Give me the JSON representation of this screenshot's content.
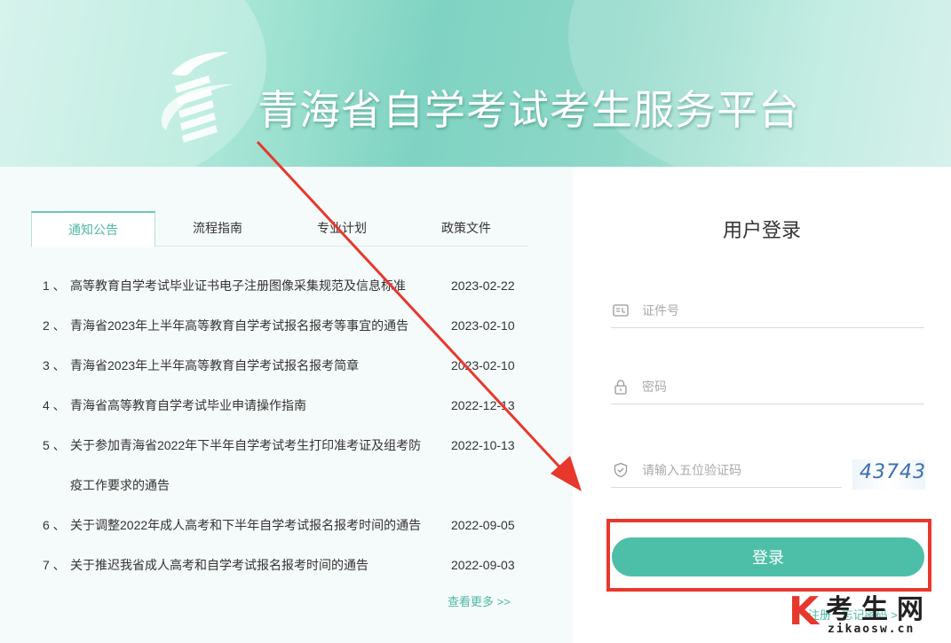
{
  "header": {
    "site_title": "青海省自学考试考生服务平台",
    "logo": "zikao-logo"
  },
  "tabs": [
    {
      "label": "通知公告",
      "active": true
    },
    {
      "label": "流程指南",
      "active": false
    },
    {
      "label": "专业计划",
      "active": false
    },
    {
      "label": "政策文件",
      "active": false
    }
  ],
  "news": [
    {
      "num": "1 、",
      "title": "高等教育自学考试毕业证书电子注册图像采集规范及信息标准",
      "date": "2023-02-22"
    },
    {
      "num": "2 、",
      "title": "青海省2023年上半年高等教育自学考试报名报考等事宜的通告",
      "date": "2023-02-10"
    },
    {
      "num": "3 、",
      "title": "青海省2023年上半年高等教育自学考试报名报考简章",
      "date": "2023-02-10"
    },
    {
      "num": "4 、",
      "title": "青海省高等教育自学考试毕业申请操作指南",
      "date": "2022-12-13"
    },
    {
      "num": "5 、",
      "title": "关于参加青海省2022年下半年自学考试考生打印准考证及组考防疫工作要求的通告",
      "date": "2022-10-13"
    },
    {
      "num": "6 、",
      "title": "关于调整2022年成人高考和下半年自学考试报名报考时间的通告",
      "date": "2022-09-05"
    },
    {
      "num": "7 、",
      "title": "关于推迟我省成人高考和自学考试报名报考时间的通告",
      "date": "2022-09-03"
    }
  ],
  "more_label": "查看更多 >>",
  "login": {
    "title": "用户登录",
    "id_placeholder": "证件号",
    "password_placeholder": "密码",
    "captcha_placeholder": "请输入五位验证码",
    "captcha_code": "43743",
    "button_label": "登录",
    "register_label": "注册",
    "forgot_label": "忘记密码 >"
  },
  "watermark": {
    "letter": "K",
    "chinese": "考生网",
    "site": "zikaosw.cn"
  },
  "colors": {
    "accent": "#4dbfa8",
    "highlight": "#e8372c"
  }
}
